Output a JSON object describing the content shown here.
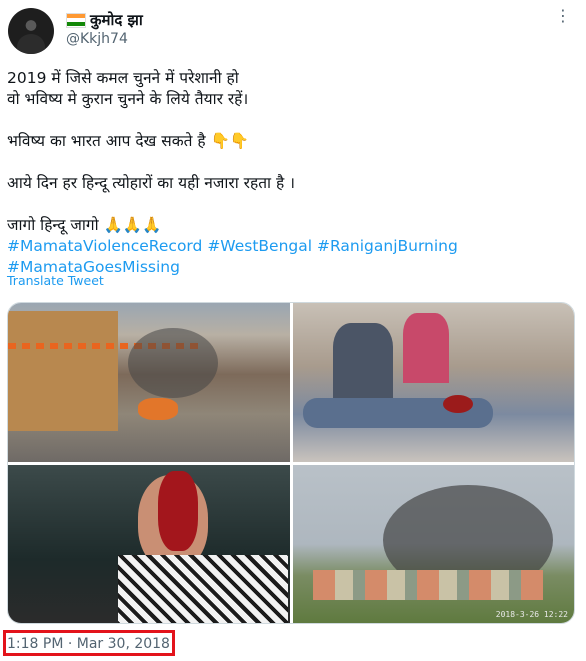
{
  "author": {
    "display_name": "कुमोद झा",
    "handle": "@Kkjh74",
    "flag_icon": "india-flag-icon",
    "flag_colors": [
      "#ff9933",
      "#ffffff",
      "#138808"
    ]
  },
  "menu_icon": "more-options-icon",
  "tweet": {
    "lines": [
      "2019 में जिसे कमल चुनने में परेशानी हो",
      "वो भविष्य मे कुरान चुनने के लिये तैयार रहें।",
      "",
      "भविष्य का भारत आप देख सकते है 👇👇",
      "",
      "आये दिन हर हिन्दू त्योहारों का यही नजारा रहता है ।",
      "",
      "जागो हिन्दू जागो 🙏🙏🙏"
    ],
    "hashtags": [
      "#MamataViolenceRecord",
      "#WestBengal",
      "#RaniganjBurning",
      "#MamataGoesMissing"
    ],
    "translate_label": "Translate Tweet"
  },
  "media": {
    "photo_4_stamp": "2018-3-26 12:22"
  },
  "timestamp": "1:18 PM · Mar 30, 2018",
  "colors": {
    "link": "#1d9bf0",
    "secondary_text": "#536471",
    "highlight_box": "#e3131b"
  }
}
